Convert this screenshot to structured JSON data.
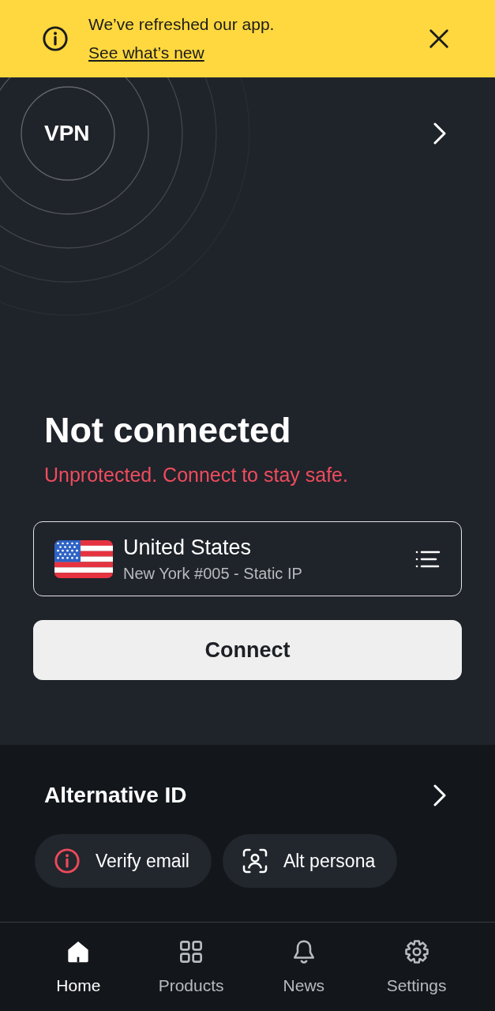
{
  "banner": {
    "message": "We’ve refreshed our app.",
    "link": "See what’s new"
  },
  "vpn": {
    "title": "VPN"
  },
  "status": {
    "title": "Not connected",
    "message": "Unprotected. Connect to stay safe."
  },
  "server": {
    "country": "United States",
    "location": "New York #005 - Static IP"
  },
  "connect_button": {
    "label": "Connect"
  },
  "alternative_id": {
    "title": "Alternative ID",
    "chips": [
      {
        "kind": "alert",
        "label": "Verify email"
      },
      {
        "kind": "persona",
        "label": "Alt persona"
      }
    ]
  },
  "nav": {
    "items": [
      {
        "kind": "home",
        "label": "Home",
        "selected": true
      },
      {
        "kind": "grid",
        "label": "Products",
        "selected": false
      },
      {
        "kind": "bell",
        "label": "News",
        "selected": false
      },
      {
        "kind": "gear",
        "label": "Settings",
        "selected": false
      }
    ]
  }
}
